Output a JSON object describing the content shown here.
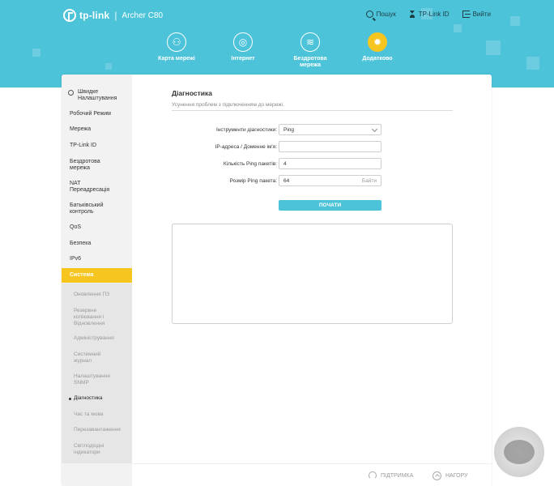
{
  "app": {
    "brand": "tp-link",
    "model": "Archer C80"
  },
  "top_links": {
    "search": "Пошук",
    "account": "TP-Link ID",
    "logout": "Вийти"
  },
  "nav": [
    {
      "label": "Карта мережі",
      "icon": "network-map-icon"
    },
    {
      "label": "Інтернет",
      "icon": "globe-icon"
    },
    {
      "label": "Бездротова мережа",
      "icon": "wifi-icon"
    },
    {
      "label": "Додатково",
      "icon": "gear-icon",
      "active": true
    }
  ],
  "sidebar": {
    "items": [
      {
        "label": "Швидке Налаштування"
      },
      {
        "label": "Робочий Режим"
      },
      {
        "label": "Мережа"
      },
      {
        "label": "TP-Link ID"
      },
      {
        "label": "Бездротова мережа"
      },
      {
        "label": "NAT Переадресація"
      },
      {
        "label": "Батьківський контроль"
      },
      {
        "label": "QoS"
      },
      {
        "label": "Безпека"
      },
      {
        "label": "IPv6"
      },
      {
        "label": "Система",
        "active": true
      }
    ],
    "sub_items": [
      {
        "label": "Оновлення ПЗ"
      },
      {
        "label": "Резервне копіювання і Відновлення"
      },
      {
        "label": "Адміністрування"
      },
      {
        "label": "Системний журнал"
      },
      {
        "label": "Налаштування SNMP"
      },
      {
        "label": "Діагностика",
        "current": true
      },
      {
        "label": "Час та мова"
      },
      {
        "label": "Перезавантаження"
      },
      {
        "label": "Світлодіодні індикатори"
      }
    ]
  },
  "main": {
    "title": "Діагностика",
    "subtitle": "Усунення проблем з підключенням до мережі.",
    "form": {
      "tool_label": "Інструменти діагностики:",
      "tool_value": "Ping",
      "ip_label": "IP-адреса / Доменне ім'я:",
      "ip_value": "",
      "count_label": "Кількість Ping пакетів:",
      "count_value": "4",
      "size_label": "Розмір Ping пакета:",
      "size_value": "64",
      "size_unit": "Байти"
    },
    "start_button": "ПОЧАТИ"
  },
  "footer": {
    "support": "ПІДТРИМКА",
    "top": "НАГОРУ"
  },
  "colors": {
    "header": "#4cc3d9",
    "accent": "#f6c51f",
    "button": "#4cc3d9"
  }
}
